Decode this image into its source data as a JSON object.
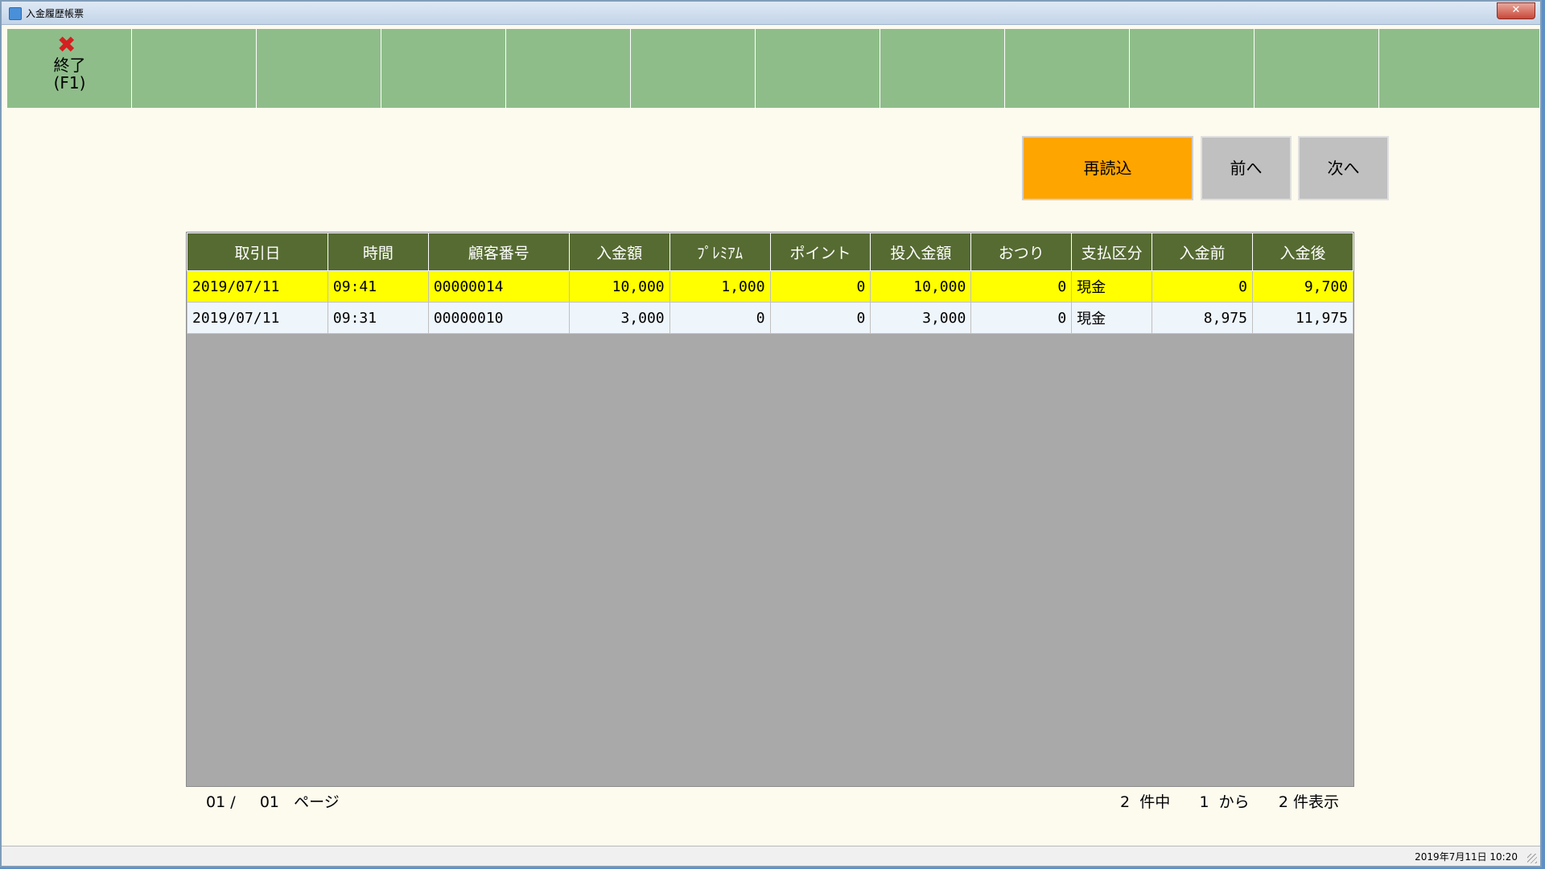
{
  "window": {
    "title": "入金履歴帳票",
    "close_symbol": "✕"
  },
  "toolbar": {
    "exit_icon": "close-x-icon",
    "exit_label": "終了\n(F1)",
    "empty_slots": 11
  },
  "buttons": {
    "reload": "再読込",
    "prev": "前へ",
    "next": "次へ"
  },
  "table": {
    "columns": [
      "取引日",
      "時間",
      "顧客番号",
      "入金額",
      "ﾌﾟﾚﾐｱﾑ",
      "ポイント",
      "投入金額",
      "おつり",
      "支払区分",
      "入金前",
      "入金後"
    ],
    "rows": [
      {
        "date": "2019/07/11",
        "time": "09:41",
        "customer": "00000014",
        "deposit": "10,000",
        "premium": "1,000",
        "points": "0",
        "inserted": "10,000",
        "change": "0",
        "payment": "現金",
        "before": "0",
        "after": "9,700",
        "selected": true
      },
      {
        "date": "2019/07/11",
        "time": "09:31",
        "customer": "00000010",
        "deposit": "3,000",
        "premium": "0",
        "points": "0",
        "inserted": "3,000",
        "change": "0",
        "payment": "現金",
        "before": "8,975",
        "after": "11,975",
        "selected": false
      }
    ]
  },
  "footer": {
    "page_current": "01",
    "page_sep": "/",
    "page_total": "01",
    "page_label": "ページ",
    "total_count": "2",
    "total_label": "件中",
    "from_index": "1",
    "from_label": "から",
    "shown_count": "2",
    "shown_label": "件表示"
  },
  "status": {
    "datetime": "2019年7月11日 10:20"
  },
  "colors": {
    "toolbar_bg": "#8fbd8a",
    "header_bg": "#566b32",
    "selected_row": "#ffff00",
    "reload_button": "#ffa500",
    "grid_empty": "#a9a9a9",
    "window_bg": "#fdfaee"
  }
}
